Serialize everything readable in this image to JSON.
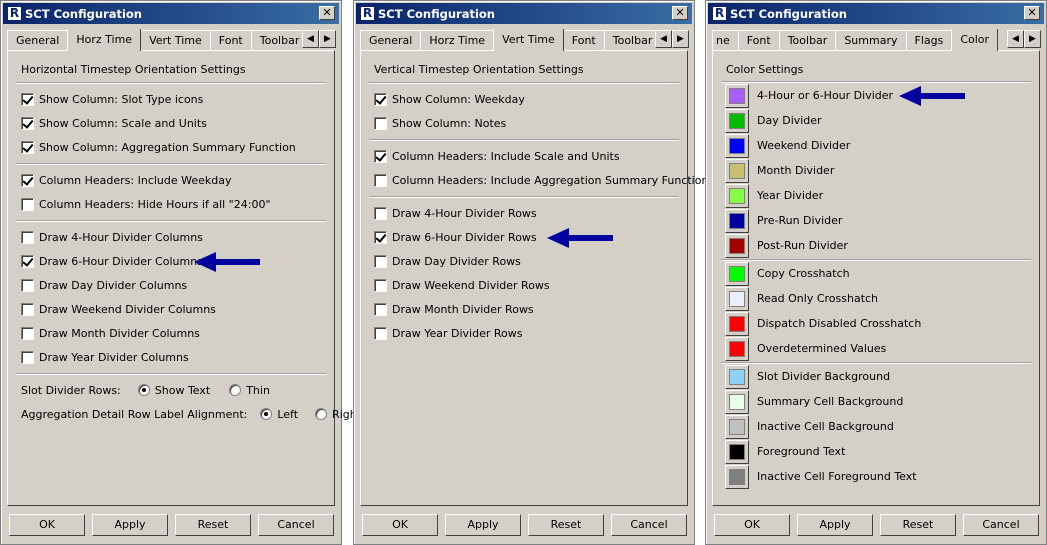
{
  "windows": [
    {
      "title": "SCT Configuration",
      "tabs": [
        "General",
        "Horz Time",
        "Vert Time",
        "Font",
        "Toolbar"
      ],
      "section_title": "Horizontal Timestep Orientation Settings",
      "groups": [
        [
          {
            "label": "Show Column: Slot Type icons",
            "checked": true
          },
          {
            "label": "Show Column: Scale and Units",
            "checked": true
          },
          {
            "label": "Show Column: Aggregation Summary Function",
            "checked": true
          }
        ],
        [
          {
            "label": "Column Headers: Include Weekday",
            "checked": true
          },
          {
            "label": "Column Headers: Hide Hours if all \"24:00\"",
            "checked": false
          }
        ],
        [
          {
            "label": "Draw 4-Hour Divider Columns",
            "checked": false
          },
          {
            "label": "Draw 6-Hour Divider Columns",
            "checked": true
          },
          {
            "label": "Draw Day Divider Columns",
            "checked": false
          },
          {
            "label": "Draw Weekend Divider Columns",
            "checked": false
          },
          {
            "label": "Draw Month Divider Columns",
            "checked": false
          },
          {
            "label": "Draw Year Divider Columns",
            "checked": false
          }
        ]
      ],
      "slot_divider": {
        "label": "Slot Divider Rows:",
        "opt1": "Show Text",
        "opt2": "Thin",
        "selected": 1
      },
      "alignment": {
        "label": "Aggregation Detail Row Label Alignment:",
        "opt1": "Left",
        "opt2": "Right",
        "selected": 1
      }
    },
    {
      "title": "SCT Configuration",
      "tabs": [
        "General",
        "Horz Time",
        "Vert Time",
        "Font",
        "Toolbar"
      ],
      "section_title": "Vertical Timestep Orientation Settings",
      "groups": [
        [
          {
            "label": "Show Column: Weekday",
            "checked": true
          },
          {
            "label": "Show Column: Notes",
            "checked": false
          }
        ],
        [
          {
            "label": "Column Headers: Include Scale and Units",
            "checked": true
          },
          {
            "label": "Column Headers: Include Aggregation Summary Function",
            "checked": false
          }
        ],
        [
          {
            "label": "Draw 4-Hour Divider Rows",
            "checked": false
          },
          {
            "label": "Draw 6-Hour Divider Rows",
            "checked": true
          },
          {
            "label": "Draw Day Divider Rows",
            "checked": false
          },
          {
            "label": "Draw Weekend Divider Rows",
            "checked": false
          },
          {
            "label": "Draw Month Divider Rows",
            "checked": false
          },
          {
            "label": "Draw Year Divider Rows",
            "checked": false
          }
        ]
      ]
    },
    {
      "title": "SCT Configuration",
      "tabs": [
        "ne",
        "Font",
        "Toolbar",
        "Summary",
        "Flags",
        "Color"
      ],
      "section_title": "Color Settings",
      "colors": [
        {
          "label": "4-Hour or 6-Hour Divider",
          "color": "#a95fff"
        },
        {
          "label": "Day Divider",
          "color": "#00bb00"
        },
        {
          "label": "Weekend Divider",
          "color": "#0000ff"
        },
        {
          "label": "Month Divider",
          "color": "#c8c070"
        },
        {
          "label": "Year Divider",
          "color": "#88ff44"
        },
        {
          "label": "Pre-Run Divider",
          "color": "#0000a0"
        },
        {
          "label": "Post-Run Divider",
          "color": "#a00000"
        },
        {
          "label": "Copy Crosshatch",
          "color": "#00ff00"
        },
        {
          "label": "Read Only Crosshatch",
          "color": "#e8f0ff"
        },
        {
          "label": "Dispatch Disabled Crosshatch",
          "color": "#ff0000"
        },
        {
          "label": "Overdetermined Values",
          "color": "#ff0000"
        },
        {
          "label": "Slot Divider Background",
          "color": "#8fd0f8"
        },
        {
          "label": "Summary Cell Background",
          "color": "#e8ffe8"
        },
        {
          "label": "Inactive Cell Background",
          "color": "#c0c0c0"
        },
        {
          "label": "Foreground Text",
          "color": "#000000"
        },
        {
          "label": "Inactive Cell Foreground Text",
          "color": "#808080"
        }
      ]
    }
  ],
  "buttons": {
    "ok": "OK",
    "apply": "Apply",
    "reset": "Reset",
    "cancel": "Cancel"
  },
  "icons": {
    "app": "rw-app-icon",
    "close": "close-icon",
    "scroll_left": "arrow-left-icon",
    "scroll_right": "arrow-right-icon",
    "annotation": "arrow-annotation-icon"
  },
  "accent_colors": {
    "titlebar": "#0a246a",
    "annotation_arrow": "#0000a0",
    "dialog_face": "#d4d0c8"
  }
}
